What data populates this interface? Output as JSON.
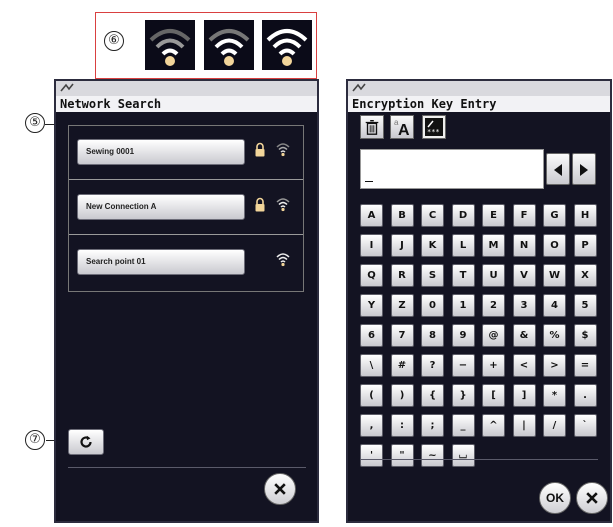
{
  "callouts": {
    "c5": "⑤",
    "c6": "⑥",
    "c7": "⑦"
  },
  "network_search": {
    "title": "Network Search",
    "networks": [
      {
        "name": "Sewing 0001",
        "locked": true,
        "signal": "weak"
      },
      {
        "name": "New Connection A",
        "locked": true,
        "signal": "medium"
      },
      {
        "name": "Search point 01",
        "locked": false,
        "signal": "strong"
      }
    ],
    "refresh_icon": "refresh-icon",
    "close_icon": "close-icon"
  },
  "signal_legend": [
    "weak",
    "medium",
    "strong"
  ],
  "encryption": {
    "title": "Encryption Key Entry",
    "toolbar": [
      "trash-icon",
      "case-toggle-icon",
      "masked-key-icon"
    ],
    "key_value": "",
    "keys": [
      [
        "A",
        "B",
        "C",
        "D",
        "E",
        "F",
        "G",
        "H"
      ],
      [
        "I",
        "J",
        "K",
        "L",
        "M",
        "N",
        "O",
        "P"
      ],
      [
        "Q",
        "R",
        "S",
        "T",
        "U",
        "V",
        "W",
        "X"
      ],
      [
        "Y",
        "Z",
        "0",
        "1",
        "2",
        "3",
        "4",
        "5"
      ],
      [
        "6",
        "7",
        "8",
        "9",
        "@",
        "&",
        "%",
        "$"
      ],
      [
        "\\",
        "#",
        "?",
        "−",
        "+",
        "<",
        ">",
        "="
      ],
      [
        "(",
        ")",
        "{",
        "}",
        "[",
        "]",
        "*",
        "."
      ],
      [
        ",",
        ":",
        ";",
        "_",
        "^",
        "|",
        "/",
        "`"
      ],
      [
        "'",
        "\"",
        "~",
        "⌴"
      ]
    ],
    "ok_label": "OK"
  },
  "colors": {
    "callout_red": "#d94040",
    "screen_bg": "#131322",
    "signal_gold": "#f2d59a"
  }
}
